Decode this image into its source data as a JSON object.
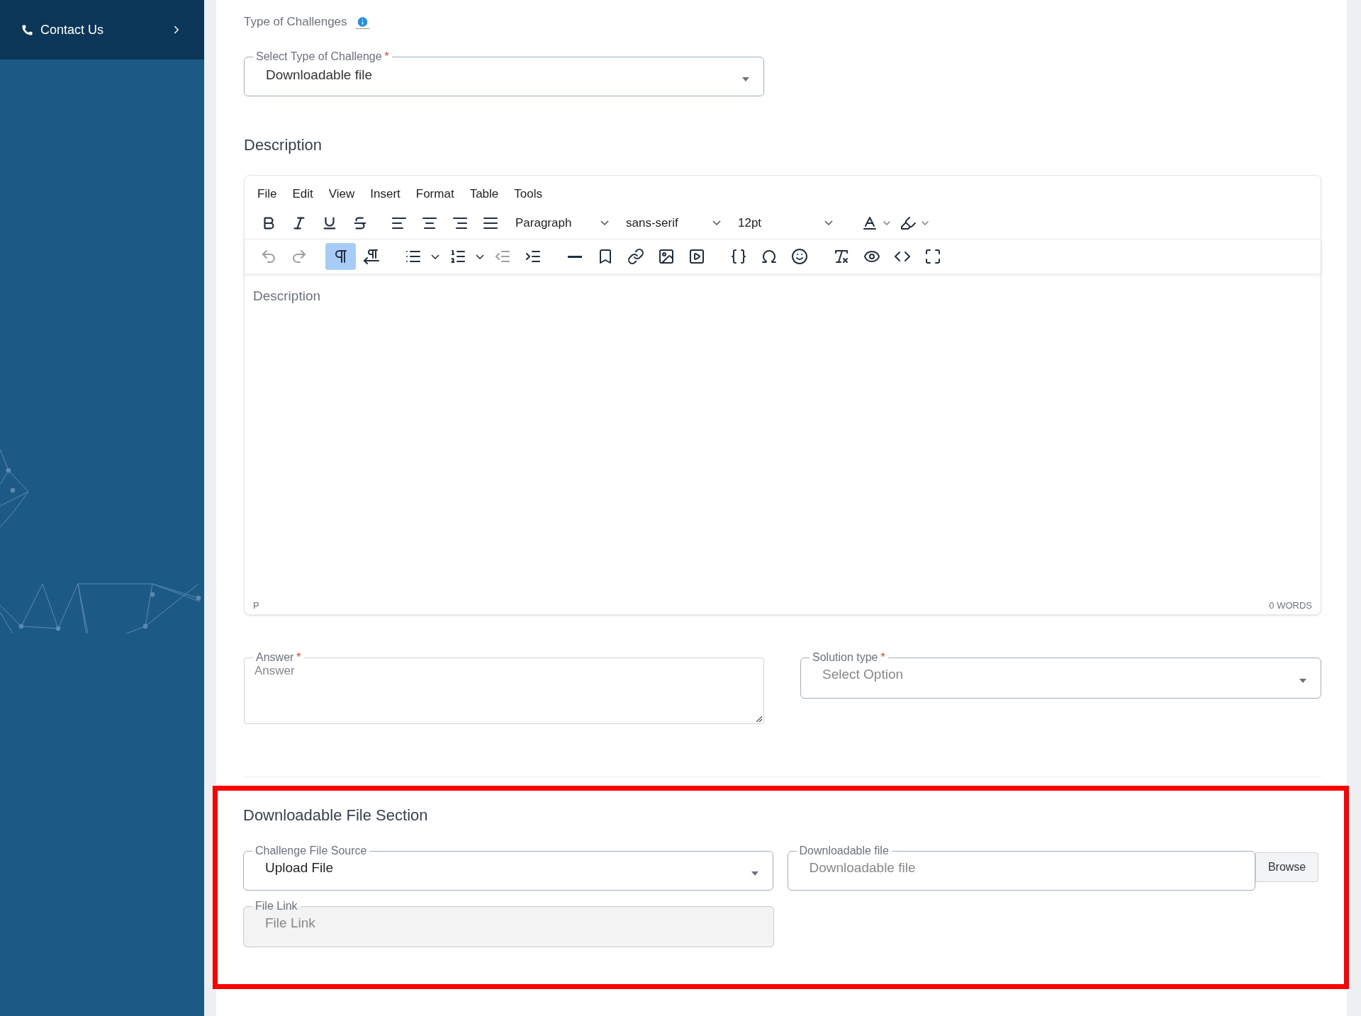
{
  "sidebar": {
    "contact_item": {
      "label": "Contact Us"
    }
  },
  "type_of_challenges": {
    "label": "Type of Challenges",
    "select": {
      "label": "Select Type of Challenge",
      "required_mark": "*",
      "value": "Downloadable file"
    }
  },
  "description": {
    "heading": "Description",
    "editor": {
      "menu": [
        "File",
        "Edit",
        "View",
        "Insert",
        "Format",
        "Table",
        "Tools"
      ],
      "block_format": "Paragraph",
      "font_family": "sans-serif",
      "font_size": "12pt",
      "toolbar_row_2": [
        {
          "disabled": true,
          "selected": false
        },
        {
          "disabled": true,
          "selected": false
        },
        {
          "disabled": false,
          "selected": true
        },
        {
          "disabled": false,
          "selected": false
        },
        {
          "disabled": false,
          "selected": false
        },
        {
          "disabled": false,
          "selected": false
        },
        {
          "disabled": false,
          "selected": false
        },
        {
          "disabled": false,
          "selected": false
        },
        {
          "disabled": true,
          "selected": false
        },
        {
          "disabled": false,
          "selected": false
        },
        {
          "disabled": false,
          "selected": false
        },
        {
          "disabled": false,
          "selected": false
        },
        {
          "disabled": false,
          "selected": false
        },
        {
          "disabled": false,
          "selected": false
        },
        {
          "disabled": false,
          "selected": false
        },
        {
          "disabled": false,
          "selected": false
        },
        {
          "disabled": false,
          "selected": false
        },
        {
          "disabled": false,
          "selected": false
        },
        {
          "disabled": false,
          "selected": false
        },
        {
          "disabled": false,
          "selected": false
        }
      ],
      "placeholder": "Description",
      "path": "P",
      "word_count": "0 WORDS"
    }
  },
  "answer": {
    "label": "Answer",
    "required_mark": "*",
    "placeholder": "Answer"
  },
  "solution_type": {
    "label": "Solution type",
    "required_mark": "*",
    "placeholder": "Select Option"
  },
  "downloadable_section": {
    "highlighted": true,
    "heading": "Downloadable File Section",
    "file_source": {
      "label": "Challenge File Source",
      "value": "Upload File"
    },
    "downloadable_file": {
      "label": "Downloadable file",
      "placeholder": "Downloadable file",
      "button": "Browse"
    },
    "file_link": {
      "label": "File Link",
      "placeholder": "File Link",
      "disabled": true
    }
  }
}
